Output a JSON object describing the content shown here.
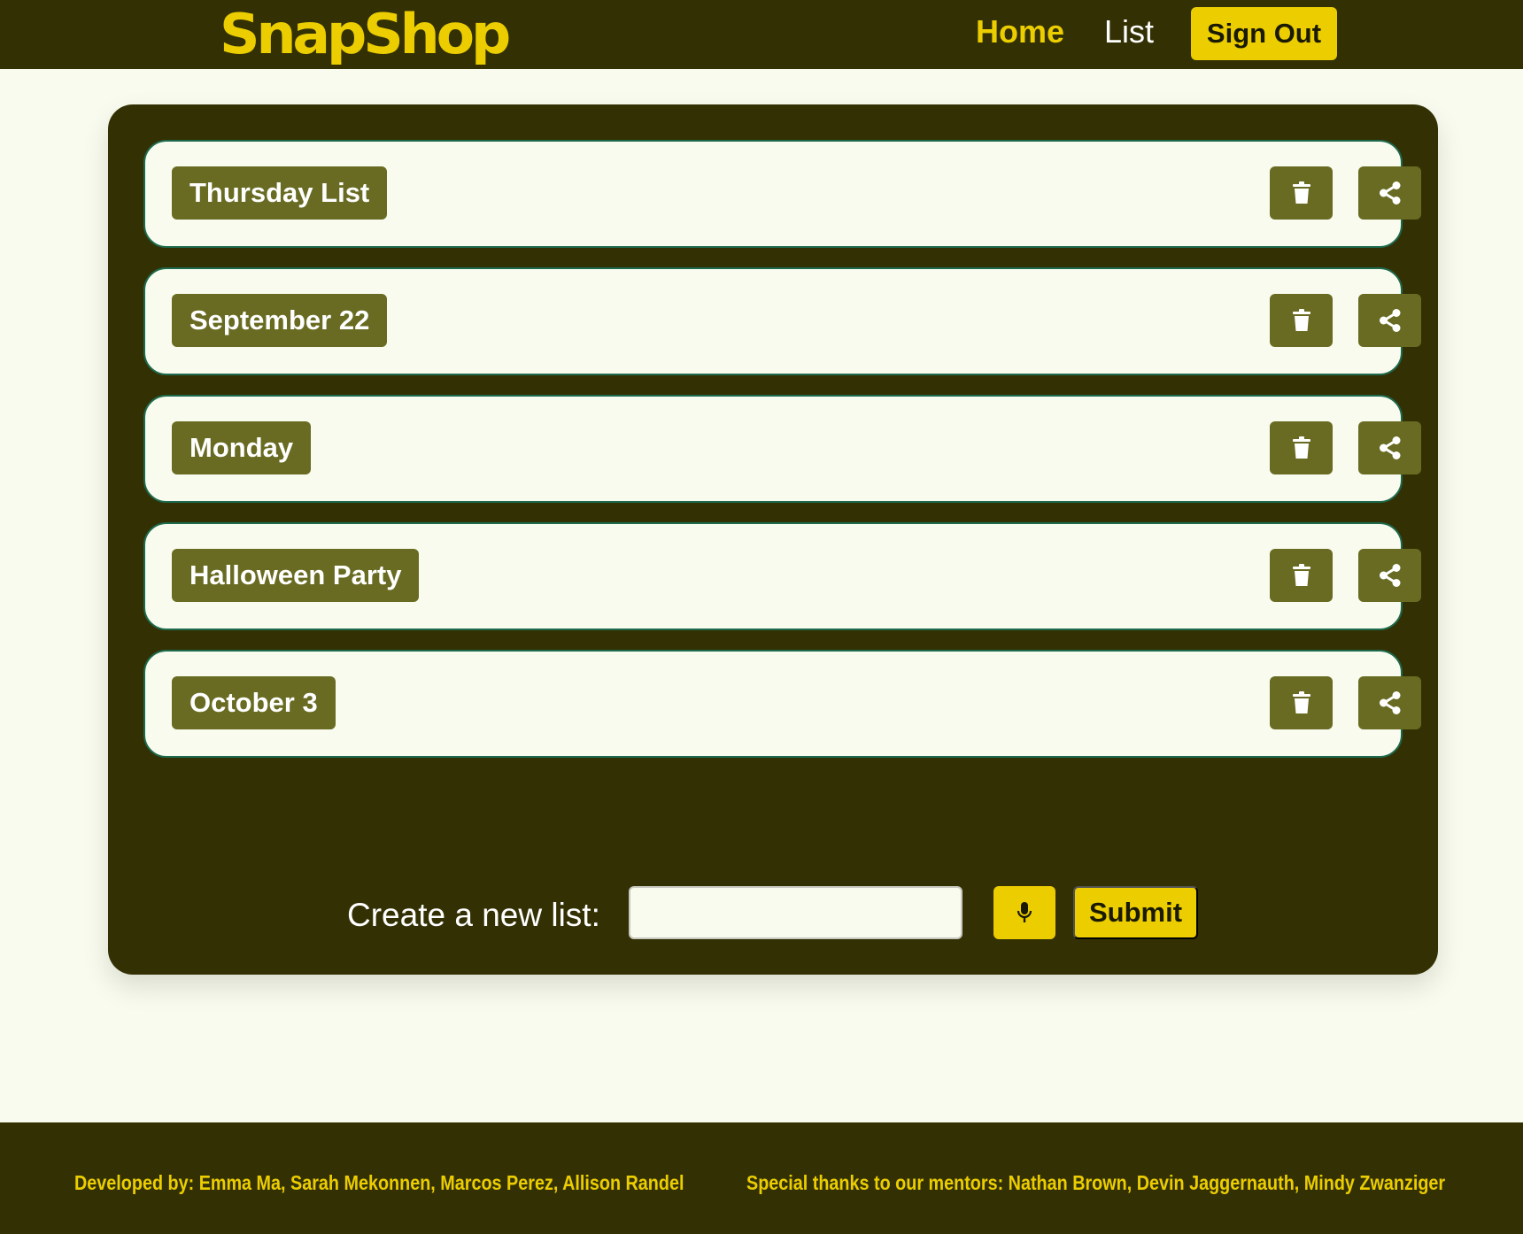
{
  "header": {
    "logo": "SnapShop",
    "nav": {
      "home": "Home",
      "list": "List"
    },
    "sign_out": "Sign Out"
  },
  "lists": [
    {
      "name": "Thursday List",
      "delete_icon": "trash-icon",
      "share_icon": "share-icon"
    },
    {
      "name": "September 22",
      "delete_icon": "trash-icon",
      "share_icon": "share-icon"
    },
    {
      "name": "Monday",
      "delete_icon": "trash-icon",
      "share_icon": "share-icon"
    },
    {
      "name": "Halloween Party",
      "delete_icon": "trash-icon",
      "share_icon": "share-icon"
    },
    {
      "name": "October 3",
      "delete_icon": "trash-icon",
      "share_icon": "share-icon"
    }
  ],
  "create": {
    "label": "Create a new list:",
    "input_value": "",
    "mic_icon": "microphone-icon",
    "submit": "Submit"
  },
  "footer": {
    "developers": "Developed by: Emma Ma, Sarah Mekonnen, Marcos Perez, Allison Randel",
    "mentors": "Special thanks to our mentors: Nathan Brown, Devin Jaggernauth, Mindy Zwanziger"
  },
  "colors": {
    "dark_olive": "#333104",
    "accent_yellow": "#ebcd00",
    "button_olive": "#686b21",
    "background": "#f8fbed"
  }
}
